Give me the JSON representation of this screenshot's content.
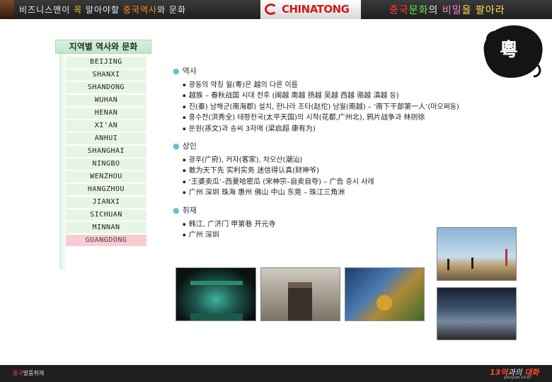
{
  "header": {
    "tagline_left_a": "비즈니스맨이 ",
    "tagline_left_b": "꼭",
    "tagline_left_c": " 알아야할 ",
    "tagline_left_d": "중국역사",
    "tagline_left_e": "와 문화",
    "logo": "CHINATONG",
    "tagline_right_a": "중국",
    "tagline_right_b": "문화",
    "tagline_right_c": "의 ",
    "tagline_right_d": "비밀",
    "tagline_right_e": "을 팔아라"
  },
  "seal": {
    "char": "粵"
  },
  "nav": {
    "title": "지역별 역사와 문화",
    "items": [
      "BEIJING",
      "SHANXI",
      "SHANDONG",
      "WUHAN",
      "HENAN",
      "XI'AN",
      "ANHUI",
      "SHANGHAI",
      "NINGBO",
      "WENZHOU",
      "HANGZHOU",
      "JIANXI",
      "SICHUAN",
      "MINNAN",
      "GUANGDONG"
    ],
    "active": "GUANGDONG"
  },
  "sections": [
    {
      "title": "역사",
      "items": [
        "광동의 약칭 월(粵)은 越의 다른 이름",
        "越族 – 春秋战国 시대 전후 (闽越 南越 扬越 吴越 西越 骆越 滇越 등)",
        "진(秦) 남해군(南海郡) 설치, 한나라 조타(赵佗) 남월(南越) – ‘南下干部第一人’(마오쩌둥)",
        "홍수전(洪秀全) 태평천국(太平天国)의 시작(花都,广州北), 鸦片战争과 林则徐",
        "쑨원(孫文)과 송씨 3자매 (梁启超 康有为)"
      ]
    },
    {
      "title": "상인",
      "items": [
        "광푸(广府), 커자(客家), 차오산(潮汕)",
        "敢为天下先 实利实务 迷信得认真(财神爷)",
        "‘王婆卖瓜’–西夏哈密瓜 (宋神宗–自卖自夸) – 广告 중시 사례",
        "广州 深圳 珠海 惠州 佛山 中山 东莞 – 珠江三角洲"
      ]
    },
    {
      "title": "취재",
      "items": [
        "韩江, 广济门 甲第巷 开元寺",
        "广州 深圳"
      ]
    }
  ],
  "footer": {
    "left_a": "중국",
    "left_b": "발품취재",
    "right_a": "13억",
    "right_b": "과의 ",
    "right_c": "대화",
    "url": "youyue.co.kr"
  },
  "colors": {
    "nav_item_bg": "#e6f6e3",
    "nav_active_bg": "#f7cdd3",
    "nav_title_bg": "#c9ecd2",
    "bullet_dot": "#7ab6d6",
    "logo_red": "#d41a1a"
  }
}
